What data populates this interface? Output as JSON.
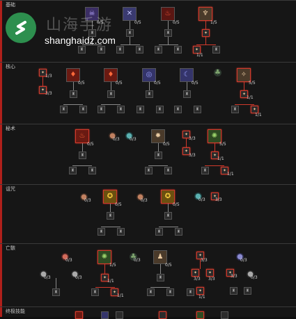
{
  "sections": [
    {
      "title": "基础"
    },
    {
      "title": "核心"
    },
    {
      "title": "秘术"
    },
    {
      "title": "诅咒"
    },
    {
      "title": "亡骸"
    },
    {
      "title": "终极技能"
    }
  ],
  "watermark": {
    "chinese": "山海手游",
    "url": "shanghaidz.com"
  },
  "counts": {
    "c05": "0/5",
    "c15": "1/5",
    "c55": "5/5",
    "c03": "0/3",
    "c13": "1/3",
    "c33": "3/3",
    "c11": "1/1"
  },
  "colors": {
    "accent_red": "#b0201b",
    "active_border": "#d23a2c",
    "brand_green": "#2d8f4e"
  }
}
